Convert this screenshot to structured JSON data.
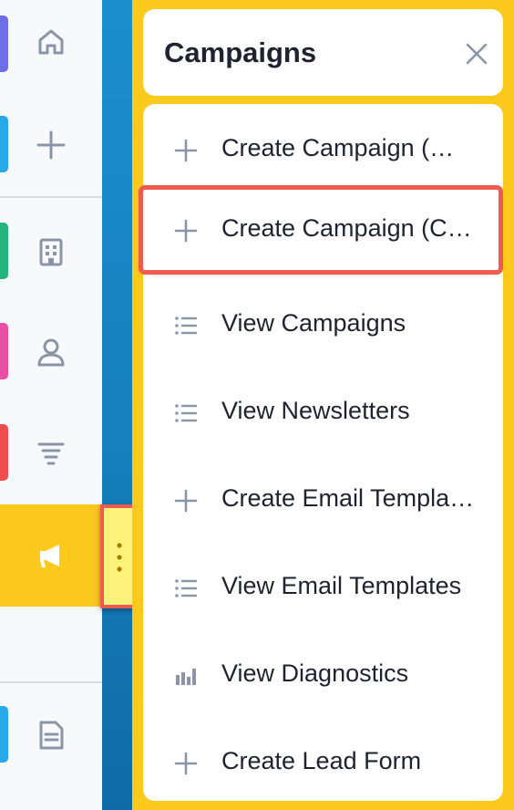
{
  "rail": {
    "items": [
      {
        "icon": "home-icon",
        "accent": "#6f6ee9"
      },
      {
        "icon": "plus-icon",
        "accent": "#27a9e8"
      },
      {
        "icon": "building-icon",
        "accent": "#24b67b"
      },
      {
        "icon": "person-icon",
        "accent": "#ea4fa7"
      },
      {
        "icon": "filter-icon",
        "accent": "#ee4e4e"
      },
      {
        "icon": "megaphone-icon",
        "accent": "#fcc91c",
        "active": true
      },
      {
        "icon": "document-icon",
        "accent": "#27a9e8"
      }
    ]
  },
  "panel": {
    "title": "Campaigns",
    "close_icon": "close-icon",
    "items": [
      {
        "icon": "plus-icon",
        "label": "Create Campaign (Classic)",
        "display": "Create Campaign (…"
      },
      {
        "icon": "plus-icon",
        "label": "Create Campaign (C…",
        "display": "Create Campaign (C…",
        "highlighted": true
      },
      {
        "icon": "list-icon",
        "label": "View Campaigns",
        "display": "View Campaigns"
      },
      {
        "icon": "list-icon",
        "label": "View Newsletters",
        "display": "View Newsletters"
      },
      {
        "icon": "plus-icon",
        "label": "Create Email Templa…",
        "display": "Create Email Templa…"
      },
      {
        "icon": "list-icon",
        "label": "View Email Templates",
        "display": "View Email Templates"
      },
      {
        "icon": "bar-chart-icon",
        "label": "View Diagnostics",
        "display": "View Diagnostics"
      },
      {
        "icon": "plus-icon",
        "label": "Create Lead Form",
        "display": "Create Lead Form"
      }
    ]
  },
  "colors": {
    "panel_bg": "#fcc91c",
    "highlight": "#ee5b4f",
    "icon_gray": "#8a96a8",
    "text": "#1f2330"
  }
}
